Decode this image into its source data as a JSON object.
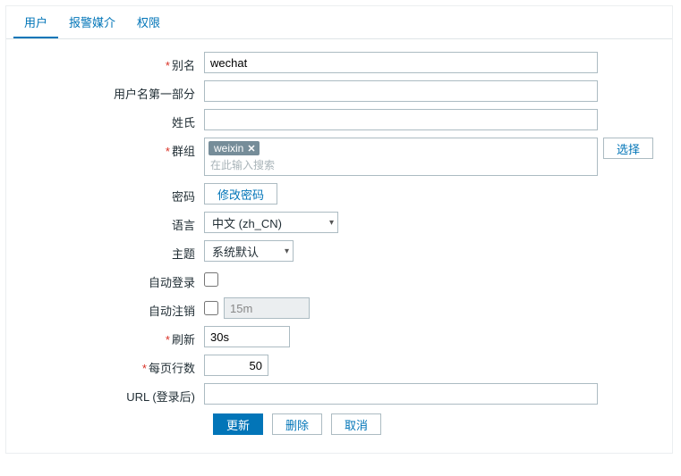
{
  "tabs": {
    "user": "用户",
    "media": "报警媒介",
    "perm": "权限"
  },
  "labels": {
    "alias": "别名",
    "name_part": "用户名第一部分",
    "surname": "姓氏",
    "groups": "群组",
    "password": "密码",
    "language": "语言",
    "theme": "主题",
    "auto_login": "自动登录",
    "auto_logout": "自动注销",
    "refresh": "刷新",
    "rows": "每页行数",
    "url_after": "URL (登录后)"
  },
  "values": {
    "alias": "wechat",
    "name_part": "",
    "surname": "",
    "group_tag": "weixin",
    "group_placeholder": "在此输入搜索",
    "language": "中文 (zh_CN)",
    "theme": "系统默认",
    "auto_login": false,
    "auto_logout_enabled": false,
    "auto_logout_value": "15m",
    "refresh": "30s",
    "rows": "50",
    "url_after": ""
  },
  "buttons": {
    "select": "选择",
    "change_pw": "修改密码",
    "update": "更新",
    "delete": "删除",
    "cancel": "取消"
  }
}
